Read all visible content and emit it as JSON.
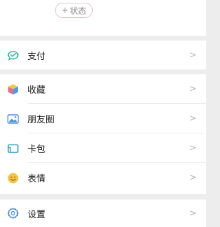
{
  "profile": {
    "status_plus": "+",
    "status_label": "状态"
  },
  "groups": [
    {
      "items": [
        {
          "label": "支付",
          "icon": "payment-icon"
        }
      ]
    },
    {
      "items": [
        {
          "label": "收藏",
          "icon": "favorites-icon"
        },
        {
          "label": "朋友圈",
          "icon": "moments-icon"
        },
        {
          "label": "卡包",
          "icon": "cards-icon"
        },
        {
          "label": "表情",
          "icon": "stickers-icon"
        }
      ]
    },
    {
      "items": [
        {
          "label": "设置",
          "icon": "settings-icon"
        }
      ]
    }
  ],
  "chevron": ">"
}
